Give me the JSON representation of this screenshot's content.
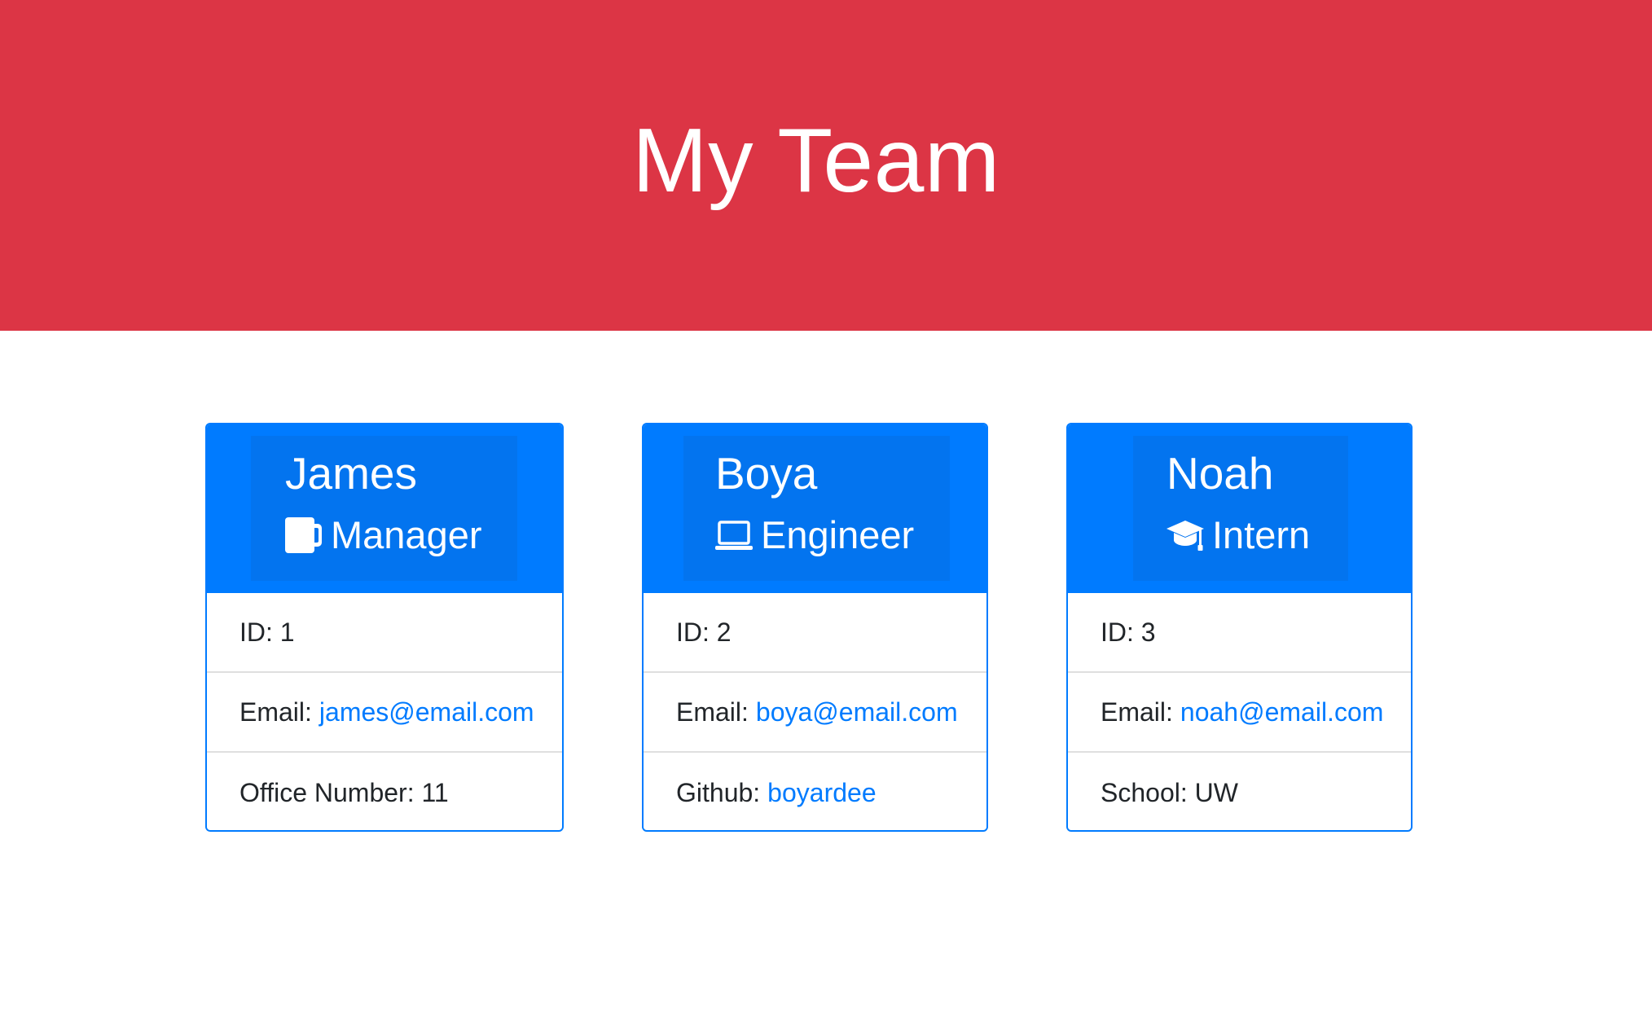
{
  "header": {
    "title": "My Team"
  },
  "colors": {
    "header_bg": "#dc3545",
    "card_accent": "#007bff",
    "link": "#007bff"
  },
  "cards": [
    {
      "name": "James",
      "role": "Manager",
      "role_icon": "mug-icon",
      "id_label": "ID: 1",
      "email_label": "Email:",
      "email": "james@email.com",
      "extra_label": "Office Number: 11"
    },
    {
      "name": "Boya",
      "role": "Engineer",
      "role_icon": "laptop-icon",
      "id_label": "ID: 2",
      "email_label": "Email:",
      "email": "boya@email.com",
      "extra_label": "Github:",
      "extra_link": "boyardee"
    },
    {
      "name": "Noah",
      "role": "Intern",
      "role_icon": "graduation-cap-icon",
      "id_label": "ID: 3",
      "email_label": "Email:",
      "email": "noah@email.com",
      "extra_label": "School: UW"
    }
  ]
}
